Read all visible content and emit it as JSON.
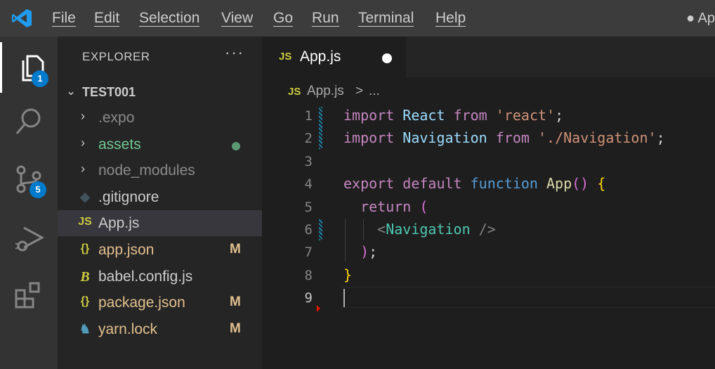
{
  "menu": [
    "File",
    "Edit",
    "Selection",
    "View",
    "Go",
    "Run",
    "Terminal",
    "Help"
  ],
  "window_title": "● Ap",
  "activity_bar": {
    "explorer_badge": "1",
    "source_control_badge": "5"
  },
  "explorer": {
    "title": "EXPLORER",
    "more": "···",
    "folder": "TEST001",
    "files": [
      {
        "name": ".expo",
        "kind": "folder",
        "status": ""
      },
      {
        "name": "assets",
        "kind": "folder",
        "status": "dot"
      },
      {
        "name": "node_modules",
        "kind": "folder",
        "status": ""
      },
      {
        "name": ".gitignore",
        "kind": "git",
        "status": ""
      },
      {
        "name": "App.js",
        "kind": "js",
        "status": ""
      },
      {
        "name": "app.json",
        "kind": "json",
        "status": "M"
      },
      {
        "name": "babel.config.js",
        "kind": "babel",
        "status": ""
      },
      {
        "name": "package.json",
        "kind": "json",
        "status": "M"
      },
      {
        "name": "yarn.lock",
        "kind": "yarn",
        "status": "M"
      }
    ]
  },
  "tab": {
    "icon": "JS",
    "label": "App.js"
  },
  "breadcrumb": {
    "icon": "JS",
    "file": "App.js",
    "separator": ">",
    "more": "..."
  },
  "editor": {
    "line_numbers": [
      "1",
      "2",
      "3",
      "4",
      "5",
      "6",
      "7",
      "8",
      "9"
    ],
    "tokens": {
      "l1_import": "import",
      "l1_react": "React",
      "l1_from": "from",
      "l1_str": "'react'",
      "l1_semi": ";",
      "l2_import": "import",
      "l2_nav": "Navigation",
      "l2_from": "from",
      "l2_str": "'./Navigation'",
      "l2_semi": ";",
      "l4_export": "export",
      "l4_default": "default",
      "l4_function": "function",
      "l4_app": "App",
      "l4_parens": "()",
      "l4_brace": "{",
      "l5_return": "return",
      "l5_paren": "(",
      "l6_lt": "<",
      "l6_tag": "Navigation",
      "l6_close": "/>",
      "l7_paren": ")",
      "l7_semi": ";",
      "l8_brace": "}"
    }
  },
  "colors": {
    "accent": "#007acc",
    "modified": "#e2c08d",
    "js_icon": "#cbcb41"
  }
}
